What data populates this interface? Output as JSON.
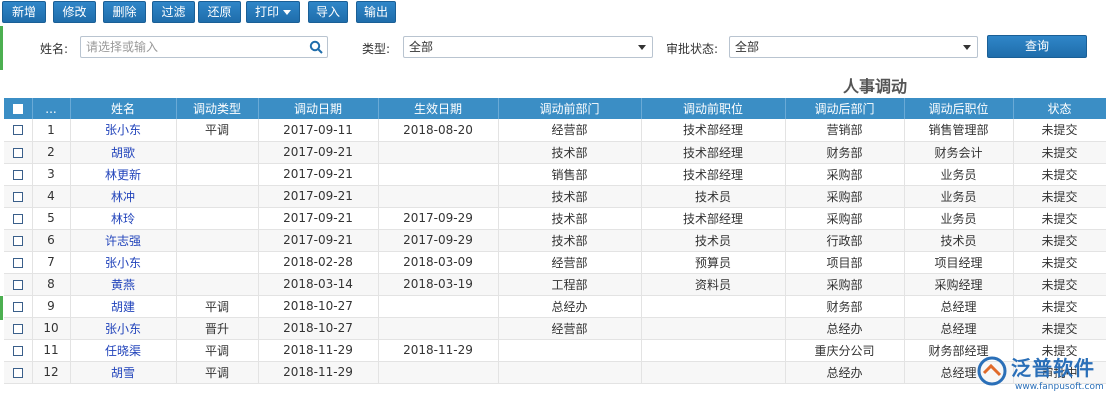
{
  "toolbar": {
    "buttons": [
      "新增",
      "修改",
      "删除",
      "过滤",
      "还原",
      "打印",
      "导入",
      "输出"
    ]
  },
  "filter": {
    "name_label": "姓名:",
    "name_placeholder": "请选择或输入",
    "type_label": "类型:",
    "type_value": "全部",
    "status_label": "审批状态:",
    "status_value": "全部",
    "query_label": "查询"
  },
  "report_title": "人事调动",
  "table": {
    "headers": [
      "...",
      "姓名",
      "调动类型",
      "调动日期",
      "生效日期",
      "调动前部门",
      "调动前职位",
      "调动后部门",
      "调动后职位",
      "状态"
    ],
    "rows": [
      [
        "1",
        "张小东",
        "平调",
        "2017-09-11",
        "2018-08-20",
        "经营部",
        "技术部经理",
        "营销部",
        "销售管理部",
        "未提交"
      ],
      [
        "2",
        "胡歌",
        "",
        "2017-09-21",
        "",
        "技术部",
        "技术部经理",
        "财务部",
        "财务会计",
        "未提交"
      ],
      [
        "3",
        "林更新",
        "",
        "2017-09-21",
        "",
        "销售部",
        "技术部经理",
        "采购部",
        "业务员",
        "未提交"
      ],
      [
        "4",
        "林冲",
        "",
        "2017-09-21",
        "",
        "技术部",
        "技术员",
        "采购部",
        "业务员",
        "未提交"
      ],
      [
        "5",
        "林玲",
        "",
        "2017-09-21",
        "2017-09-29",
        "技术部",
        "技术部经理",
        "采购部",
        "业务员",
        "未提交"
      ],
      [
        "6",
        "许志强",
        "",
        "2017-09-21",
        "2017-09-29",
        "技术部",
        "技术员",
        "行政部",
        "技术员",
        "未提交"
      ],
      [
        "7",
        "张小东",
        "",
        "2018-02-28",
        "2018-03-09",
        "经营部",
        "预算员",
        "项目部",
        "项目经理",
        "未提交"
      ],
      [
        "8",
        "黄燕",
        "",
        "2018-03-14",
        "2018-03-19",
        "工程部",
        "资料员",
        "采购部",
        "采购经理",
        "未提交"
      ],
      [
        "9",
        "胡建",
        "平调",
        "2018-10-27",
        "",
        "总经办",
        "",
        "财务部",
        "总经理",
        "未提交"
      ],
      [
        "10",
        "张小东",
        "晋升",
        "2018-10-27",
        "",
        "经营部",
        "",
        "总经办",
        "总经理",
        "未提交"
      ],
      [
        "11",
        "任晓渠",
        "平调",
        "2018-11-29",
        "2018-11-29",
        "",
        "",
        "重庆分公司",
        "财务部经理",
        "未提交"
      ],
      [
        "12",
        "胡雪",
        "平调",
        "2018-11-29",
        "",
        "",
        "",
        "总经办",
        "总经理",
        "审批中"
      ]
    ]
  },
  "watermark": {
    "brand": "泛普软件",
    "url": "www.fanpusoft.com"
  },
  "colors": {
    "button": "#1f6dab",
    "header": "#3b8ec5",
    "name_link": "#2244bb",
    "accent": "#4caf50"
  }
}
